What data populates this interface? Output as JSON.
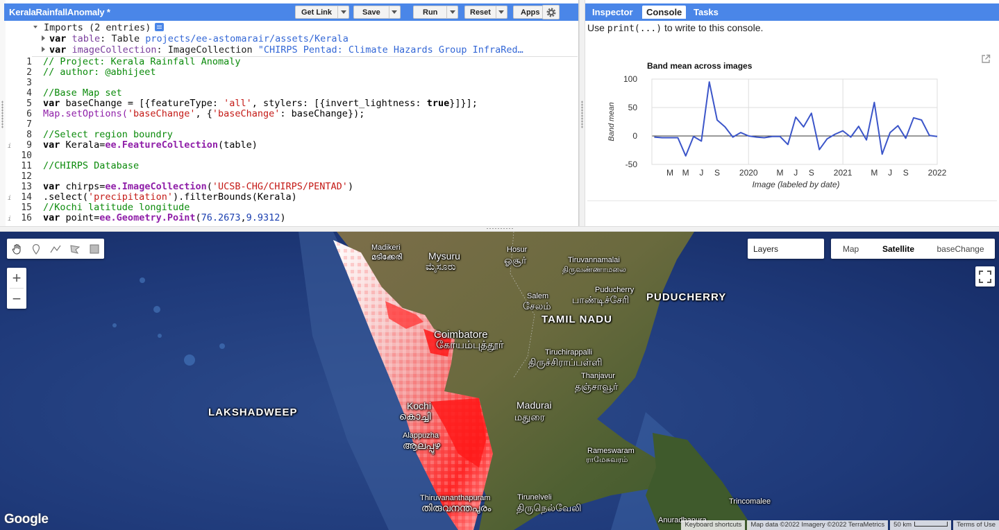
{
  "editor": {
    "script_title": "KeralaRainfallAnomaly *",
    "buttons": {
      "get_link": "Get Link",
      "save": "Save",
      "run": "Run",
      "reset": "Reset",
      "apps": "Apps"
    },
    "imports": {
      "header": "Imports (2 entries)",
      "rows": [
        {
          "kw": "var",
          "name": "table",
          "type": "Table",
          "value": "projects/ee-astomarair/assets/Kerala"
        },
        {
          "kw": "var",
          "name": "imageCollection",
          "type": "ImageCollection",
          "value": "\"CHIRPS Pentad: Climate Hazards Group InfraRed…"
        }
      ]
    },
    "code": {
      "line_numbers": [
        "1",
        "2",
        "3",
        "4",
        "5",
        "6",
        "7",
        "8",
        "9",
        "10",
        "11",
        "12",
        "13",
        "14",
        "15",
        "16"
      ],
      "l1": "// Project: Kerala Rainfall Anomaly",
      "l2": "// author: @abhijeet",
      "l4": "//Base Map set",
      "l5a": "var",
      "l5b": " baseChange = [{featureType: ",
      "l5c": "'all'",
      "l5d": ", stylers: [{invert_lightness: ",
      "l5e": "true",
      "l5f": "}]}];",
      "l6a": "Map.setOptions(",
      "l6b": "'baseChange'",
      "l6c": ", {",
      "l6d": "'baseChange'",
      "l6e": ": baseChange});",
      "l8": "//Select region boundry",
      "l9a": "var",
      "l9b": " Kerala=",
      "l9c": "ee.FeatureCollection",
      "l9d": "(table)",
      "l11": "//CHIRPS Database",
      "l13a": "var",
      "l13b": " chirps=",
      "l13c": "ee.ImageCollection",
      "l13d": "(",
      "l13e": "'UCSB-CHG/CHIRPS/PENTAD'",
      "l13f": ")",
      "l14a": ".select(",
      "l14b": "'precipitation'",
      "l14c": ").filterBounds(Kerala)",
      "l15": "//Kochi latitude longitude",
      "l16a": "var",
      "l16b": " point=",
      "l16c": "ee.Geometry.Point",
      "l16d": "(",
      "l16e": "76.2673",
      "l16f": ",",
      "l16g": "9.9312",
      "l16h": ")"
    }
  },
  "right_panel": {
    "tabs": [
      "Inspector",
      "Console",
      "Tasks"
    ],
    "active_tab": "Console",
    "hint_pre": "Use ",
    "hint_code": "print(...)",
    "hint_post": " to write to this console."
  },
  "chart_data": {
    "type": "line",
    "title": "Band mean across images",
    "xlabel": "Image (labeled by date)",
    "ylabel": "Band mean",
    "ylim": [
      -50,
      100
    ],
    "yticks": [
      100,
      50,
      0,
      -50
    ],
    "xticks": [
      "M",
      "M",
      "J",
      "S",
      "2020",
      "M",
      "J",
      "S",
      "2021",
      "M",
      "J",
      "S",
      "2022"
    ],
    "xtick_positions": [
      2,
      4,
      6,
      8,
      12,
      16,
      18,
      20,
      24,
      28,
      30,
      32,
      36
    ],
    "x_range": [
      -0.3,
      36
    ],
    "vgrid_at": [
      12,
      24
    ],
    "color": "#3b55c9",
    "x": [
      0,
      1,
      2,
      3,
      4,
      5,
      6,
      7,
      8,
      9,
      10,
      11,
      12,
      13,
      14,
      15,
      16,
      17,
      18,
      19,
      20,
      21,
      22,
      23,
      24,
      25,
      26,
      27,
      28,
      29,
      30,
      31,
      32,
      33,
      34,
      35,
      36
    ],
    "series": [
      {
        "values": [
          -2,
          -3,
          -3,
          -3,
          -35,
          -1,
          -9,
          95,
          28,
          16,
          -2,
          6,
          0,
          -2,
          -3,
          -1,
          -1,
          -15,
          33,
          16,
          40,
          -24,
          -5,
          3,
          9,
          -2,
          17,
          -7,
          59,
          -32,
          6,
          18,
          -4,
          32,
          28,
          1,
          -1
        ]
      }
    ]
  },
  "map": {
    "layers_label": "Layers",
    "map_types": [
      "Map",
      "Satellite",
      "baseChange"
    ],
    "active_map_type": "Satellite",
    "labels": [
      {
        "text": "Madikeri",
        "cls": "sm"
      },
      {
        "text": "മടിക്കേരി",
        "cls": "sm"
      },
      {
        "text": "Mysuru",
        "cls": ""
      },
      {
        "text": "ಮೈಸೂರು",
        "cls": ""
      },
      {
        "text": "Hosur",
        "cls": "sm"
      },
      {
        "text": "ஓசூர்",
        "cls": ""
      },
      {
        "text": "Tiruvannamalai",
        "cls": "sm"
      },
      {
        "text": "திருவண்ணாமலை",
        "cls": "sm"
      },
      {
        "text": "Puducherry",
        "cls": "sm"
      },
      {
        "text": "பாண்டிச்சேரி",
        "cls": ""
      },
      {
        "text": "PUDUCHERRY",
        "cls": "big"
      },
      {
        "text": "Salem",
        "cls": "sm"
      },
      {
        "text": "சேலம்",
        "cls": ""
      },
      {
        "text": "TAMIL NADU",
        "cls": "big"
      },
      {
        "text": "Coimbatore",
        "cls": ""
      },
      {
        "text": "கோயம்புத்தூர்",
        "cls": ""
      },
      {
        "text": "Tiruchirappalli",
        "cls": "sm"
      },
      {
        "text": "திருச்சிராப்பள்ளி",
        "cls": ""
      },
      {
        "text": "Thanjavur",
        "cls": "sm"
      },
      {
        "text": "தஞ்சாவூர்",
        "cls": ""
      },
      {
        "text": "LAKSHADWEEP",
        "cls": "big"
      },
      {
        "text": "Madurai",
        "cls": ""
      },
      {
        "text": "மதுரை",
        "cls": ""
      },
      {
        "text": "Alappuzha",
        "cls": "sm"
      },
      {
        "text": "ആലപ്പുഴ",
        "cls": ""
      },
      {
        "text": "Rameswaram",
        "cls": "sm"
      },
      {
        "text": "ராமேசுவரம்",
        "cls": "sm"
      },
      {
        "text": "Thiruvananthapuram",
        "cls": "sm"
      },
      {
        "text": "തിരുവനന്തപുരം",
        "cls": ""
      },
      {
        "text": "Tirunelveli",
        "cls": "sm"
      },
      {
        "text": "திருநெல்வேலி",
        "cls": ""
      },
      {
        "text": "Trincomalee",
        "cls": "sm"
      },
      {
        "text": "Anuradhapura",
        "cls": "sm"
      },
      {
        "text": "Kochi",
        "cls": ""
      },
      {
        "text": "കൊച്ചി",
        "cls": ""
      }
    ],
    "google_logo": "Google",
    "attribution": {
      "shortcuts": "Keyboard shortcuts",
      "data": "Map data ©2022 Imagery ©2022 TerraMetrics",
      "scale": "50 km",
      "terms": "Terms of Use"
    }
  }
}
